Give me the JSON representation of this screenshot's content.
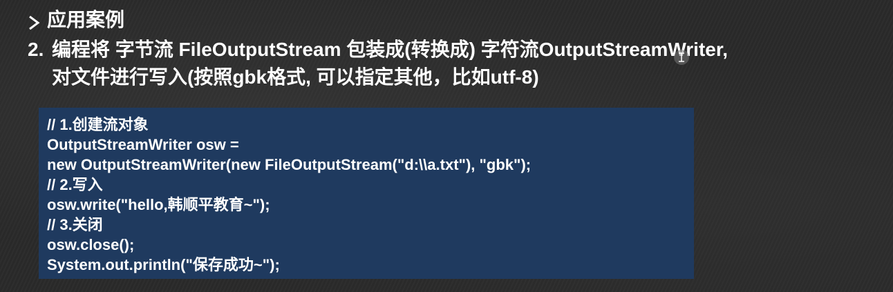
{
  "heading": {
    "label": "应用案例"
  },
  "item": {
    "number": "2.",
    "line1": "编程将 字节流 FileOutputStream 包装成(转换成) 字符流OutputStreamWriter,",
    "line2": "对文件进行写入(按照gbk格式, 可以指定其他，比如utf-8)"
  },
  "code": {
    "lines": [
      "// 1.创建流对象",
      "OutputStreamWriter osw =",
      "new OutputStreamWriter(new FileOutputStream(\"d:\\\\a.txt\"), \"gbk\");",
      "// 2.写入",
      "osw.write(\"hello,韩顺平教育~\");",
      "// 3.关闭",
      "osw.close();",
      "System.out.println(\"保存成功~\");"
    ]
  },
  "colors": {
    "background": "#2a2a2a",
    "code_background": "#1f3a5f",
    "text": "#ffffff"
  },
  "icons": {
    "bullet": "arrow-bullet-icon",
    "cursor": "text-cursor-icon"
  }
}
